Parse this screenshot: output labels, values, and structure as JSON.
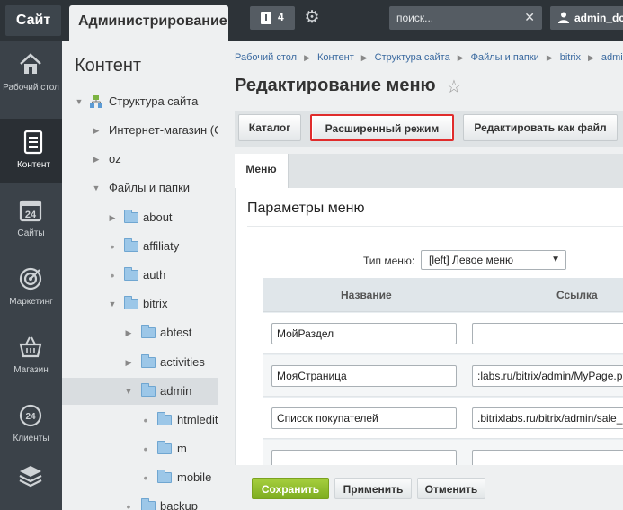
{
  "topbar": {
    "site_label": "Сайт",
    "admin_tab_label": "Администрирование",
    "notifications_count": "4",
    "search_placeholder": "поиск...",
    "user_name": "admin_dc"
  },
  "leftnav": {
    "items": [
      {
        "label": "Рабочий стол",
        "icon": "home-icon"
      },
      {
        "label": "Контент",
        "icon": "document-icon"
      },
      {
        "label": "Сайты",
        "icon": "calendar-icon"
      },
      {
        "label": "Маркетинг",
        "icon": "target-icon"
      },
      {
        "label": "Магазин",
        "icon": "basket-icon"
      },
      {
        "label": "Клиенты",
        "icon": "clients-icon"
      },
      {
        "label": "",
        "icon": "layers-icon"
      }
    ]
  },
  "tree": {
    "title": "Контент",
    "items": [
      {
        "label": "Структура сайта"
      },
      {
        "label": "Интернет-магазин (С"
      },
      {
        "label": "oz"
      },
      {
        "label": "Файлы и папки"
      },
      {
        "label": "about"
      },
      {
        "label": "affiliaty"
      },
      {
        "label": "auth"
      },
      {
        "label": "bitrix"
      },
      {
        "label": "abtest"
      },
      {
        "label": "activities"
      },
      {
        "label": "admin"
      },
      {
        "label": "htmledit"
      },
      {
        "label": "m"
      },
      {
        "label": "mobile"
      },
      {
        "label": "backup"
      }
    ]
  },
  "main": {
    "breadcrumb": [
      "Рабочий стол",
      "Контент",
      "Структура сайта",
      "Файлы и папки",
      "bitrix",
      "admin"
    ],
    "title": "Редактирование меню",
    "toolbar": {
      "catalog": "Каталог",
      "advanced": "Расширенный режим",
      "edit_as_file": "Редактировать как файл"
    },
    "tab_menu": "Меню",
    "panel_title": "Параметры меню",
    "menu_type_label": "Тип меню:",
    "menu_type_value": "[left] Левое меню",
    "columns": {
      "name": "Название",
      "link": "Ссылка"
    },
    "rows": [
      {
        "name": "МойРаздел",
        "link": ""
      },
      {
        "name": "МояСтраница",
        "link": ":labs.ru/bitrix/admin/MyPage.php"
      },
      {
        "name": "Список покупателей",
        "link": ".bitrixlabs.ru/bitrix/admin/sale_buyers.php"
      },
      {
        "name": "",
        "link": ""
      }
    ],
    "footer": {
      "save": "Сохранить",
      "apply": "Применить",
      "cancel": "Отменить"
    }
  },
  "colors": {
    "topbar_bg": "#2d3338",
    "leftnav_bg": "#3b4249",
    "save_green": "#8cbc2c",
    "highlight_red": "#e02c2c",
    "link_blue": "#3b6aa0"
  }
}
